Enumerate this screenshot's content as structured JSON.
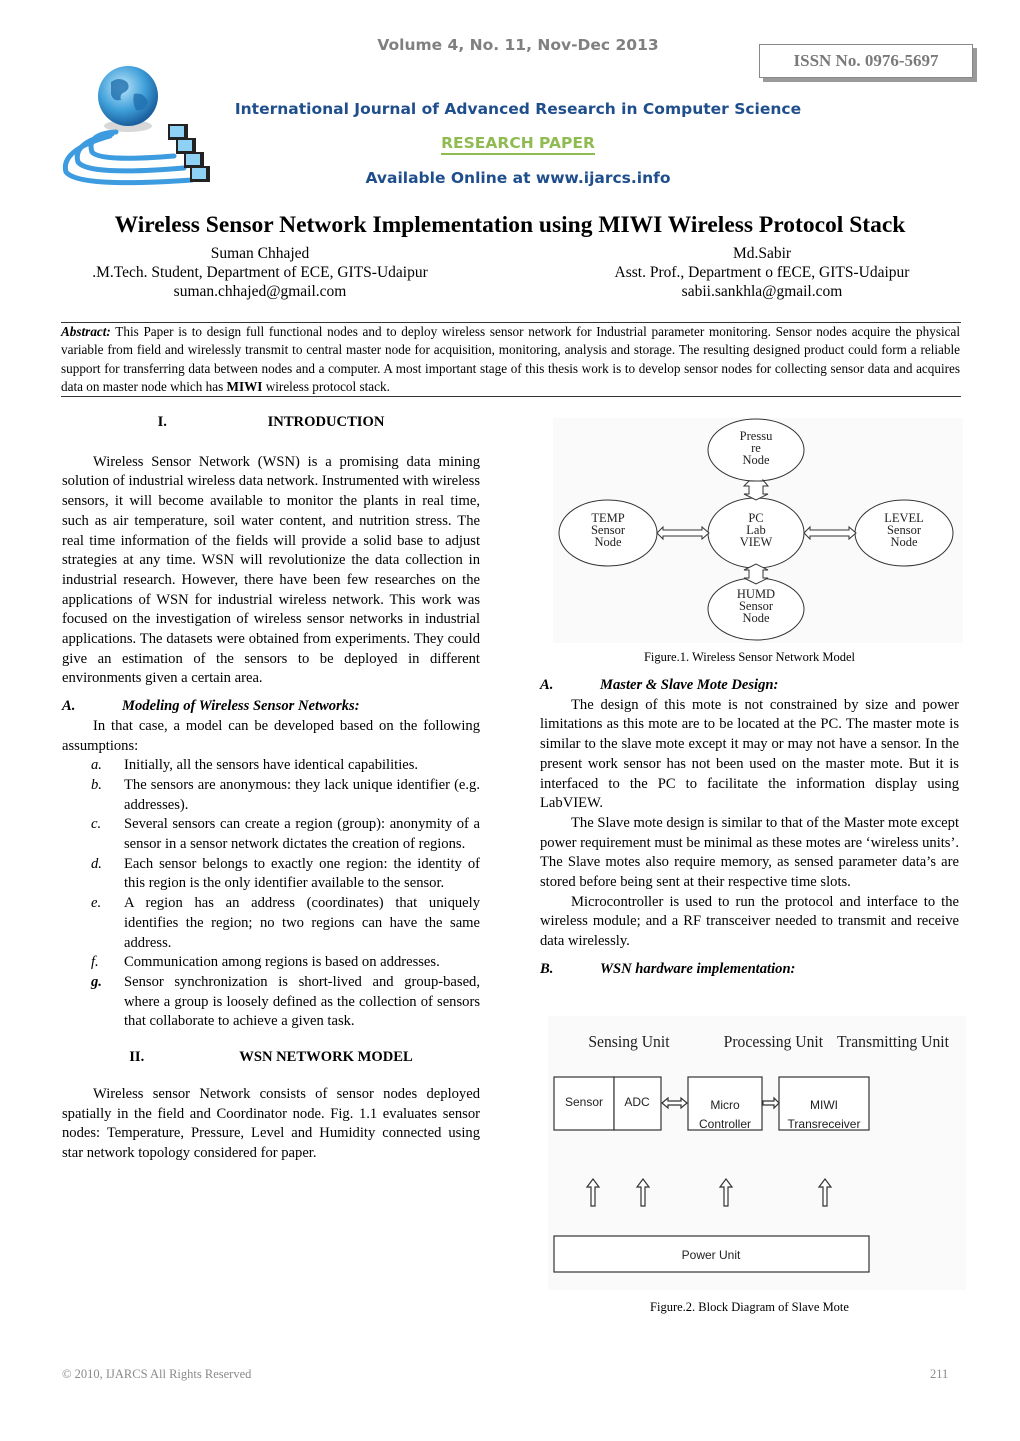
{
  "header": {
    "issn": "ISSN No. 0976-5697",
    "volume": "Volume 4, No. 11, Nov-Dec 2013",
    "journal": "International Journal of Advanced Research in Computer Science",
    "type": "RESEARCH PAPER",
    "online": "Available Online at www.ijarcs.info",
    "logo_icon": "globe-network-logo-icon",
    "colors": {
      "grey": "#808080",
      "navy": "#1f4e8c",
      "green": "#8fbb52"
    }
  },
  "paper": {
    "title": "Wireless Sensor Network Implementation using MIWI Wireless Protocol Stack",
    "authors": [
      {
        "name": "Suman Chhajed",
        "affiliation": ".M.Tech. Student, Department of ECE, GITS-Udaipur",
        "email": "suman.chhajed@gmail.com"
      },
      {
        "name": "Md.Sabir",
        "affiliation": "Asst. Prof., Department o fECE, GITS-Udaipur",
        "email": "sabii.sankhla@gmail.com"
      }
    ],
    "abstract": {
      "label": "Abstract:",
      "text_1": " This Paper is to design full functional nodes and to deploy wireless sensor network for Industrial parameter monitoring. Sensor nodes acquire the physical variable from field and wirelessly transmit to central master node for acquisition, monitoring, analysis and storage. The resulting designed product could form a reliable support for transferring data between nodes and a computer. A most important stage of this thesis work is to develop sensor nodes for collecting sensor data and acquires data on master node which has ",
      "bold": "MIWI",
      "text_2": " wireless protocol stack."
    }
  },
  "left_column": {
    "sec1": {
      "num": "I.",
      "title": "INTRODUCTION"
    },
    "intro": "Wireless Sensor Network (WSN) is a promising data mining solution of industrial wireless data network. Instrumented with wireless sensors, it will become available to monitor the plants in real time, such as air temperature, soil water content, and nutrition stress. The real time information of the fields will provide a solid base to adjust strategies at any time. WSN will revolutionize the data collection in industrial research. However, there have been few researches on the applications of WSN for industrial wireless network. This work was focused on the investigation of wireless sensor networks in industrial applications. The datasets were obtained from experiments. They could give an estimation of the sensors to be deployed in different environments given a certain area.",
    "subA": {
      "num": "A.",
      "title": "Modeling of Wireless Sensor Networks:"
    },
    "modeling_intro": "In that case, a model can be developed based on the following assumptions:",
    "assumptions": [
      {
        "mark": "a.",
        "text": "Initially, all the sensors have identical capabilities."
      },
      {
        "mark": "b.",
        "text": "The sensors are anonymous: they lack unique identifier (e.g. addresses)."
      },
      {
        "mark": "c.",
        "text": "Several sensors can create a region (group): anonymity of a sensor in a sensor network dictates the creation of regions."
      },
      {
        "mark": "d.",
        "text": "Each sensor belongs to exactly one region: the identity of this region is the only identifier available to the sensor."
      },
      {
        "mark": "e.",
        "text": "A region has an address (coordinates) that uniquely identifies the region; no two regions can have the same address."
      },
      {
        "mark": "f.",
        "text": "Communication among regions is based on addresses."
      },
      {
        "mark": "g.",
        "text": "Sensor synchronization is short-lived and group-based, where a group is loosely defined as the collection of sensors that collaborate to achieve a given task."
      }
    ],
    "sec2": {
      "num": "II.",
      "title": "WSN NETWORK MODEL"
    },
    "network_model": "Wireless sensor Network consists of sensor nodes deployed spatially in the field and Coordinator node. Fig. 1.1 evaluates sensor nodes: Temperature, Pressure, Level and Humidity connected using star network topology considered for paper."
  },
  "right_column": {
    "figure1": {
      "caption": "Figure.1. Wireless Sensor Network Model",
      "center": [
        "PC",
        "Lab",
        "VIEW"
      ],
      "top": [
        "Pressu",
        "re",
        "Node"
      ],
      "left": [
        "TEMP",
        "Sensor",
        "Node"
      ],
      "right": [
        "LEVEL",
        "Sensor",
        "Node"
      ],
      "bottom": [
        "HUMD",
        "Sensor",
        "Node"
      ]
    },
    "subA": {
      "num": "A.",
      "title": "Master & Slave Mote Design:"
    },
    "para1": "The design of this mote is not constrained by size and power limitations as this mote are to be located at the PC. The master mote is similar to the slave mote except it may or may not have a sensor. In the present work sensor has not been used on the master mote. But it is interfaced to the PC to facilitate the information display using LabVIEW.",
    "para2": "The Slave mote design is similar to that of the Master mote except power requirement must be minimal as these motes are ‘wireless units’. The Slave motes also require memory, as sensed parameter data’s are stored before being sent at their respective time slots.",
    "para3": "Microcontroller is used to run the protocol and interface to the wireless module; and a RF transceiver needed to transmit and receive data wirelessly.",
    "subB": {
      "num": "B.",
      "title": "WSN hardware implementation:"
    },
    "figure2": {
      "caption": "Figure.2. Block Diagram of Slave Mote",
      "unit_labels": [
        "Sensing Unit",
        "Processing Unit",
        "Transmitting Unit"
      ],
      "blocks": {
        "sensor": "Sensor",
        "adc": "ADC",
        "micro_1": "Micro",
        "micro_2": "Controller",
        "miwi_1": "MIWI",
        "miwi_2": "Transreceiver",
        "power": "Power Unit"
      }
    }
  },
  "footer": {
    "copyright": "© 2010, IJARCS All Rights Reserved",
    "page": "211"
  }
}
